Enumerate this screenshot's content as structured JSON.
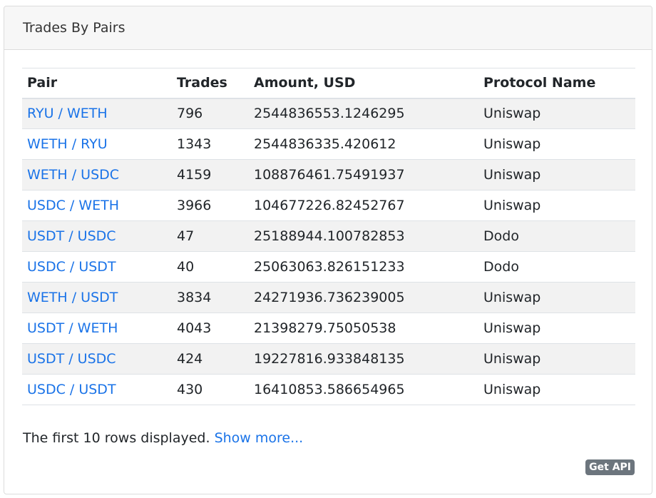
{
  "card": {
    "title": "Trades By Pairs"
  },
  "table": {
    "headers": [
      "Pair",
      "Trades",
      "Amount, USD",
      "Protocol Name"
    ],
    "rows": [
      {
        "pair": "RYU / WETH",
        "trades": "796",
        "amount": "2544836553.1246295",
        "protocol": "Uniswap"
      },
      {
        "pair": "WETH / RYU",
        "trades": "1343",
        "amount": "2544836335.420612",
        "protocol": "Uniswap"
      },
      {
        "pair": "WETH / USDC",
        "trades": "4159",
        "amount": "108876461.75491937",
        "protocol": "Uniswap"
      },
      {
        "pair": "USDC / WETH",
        "trades": "3966",
        "amount": "104677226.82452767",
        "protocol": "Uniswap"
      },
      {
        "pair": "USDT / USDC",
        "trades": "47",
        "amount": "25188944.100782853",
        "protocol": "Dodo"
      },
      {
        "pair": "USDC / USDT",
        "trades": "40",
        "amount": "25063063.826151233",
        "protocol": "Dodo"
      },
      {
        "pair": "WETH / USDT",
        "trades": "3834",
        "amount": "24271936.736239005",
        "protocol": "Uniswap"
      },
      {
        "pair": "USDT / WETH",
        "trades": "4043",
        "amount": "21398279.75050538",
        "protocol": "Uniswap"
      },
      {
        "pair": "USDT / USDC",
        "trades": "424",
        "amount": "19227816.933848135",
        "protocol": "Uniswap"
      },
      {
        "pair": "USDC / USDT",
        "trades": "430",
        "amount": "16410853.586654965",
        "protocol": "Uniswap"
      }
    ]
  },
  "footer": {
    "note": "The first 10 rows displayed.",
    "show_more": "Show more...",
    "api_badge": "Get API"
  },
  "colors": {
    "link": "#1a73e8",
    "stripe": "#f2f2f2",
    "badge": "#6c757d"
  }
}
